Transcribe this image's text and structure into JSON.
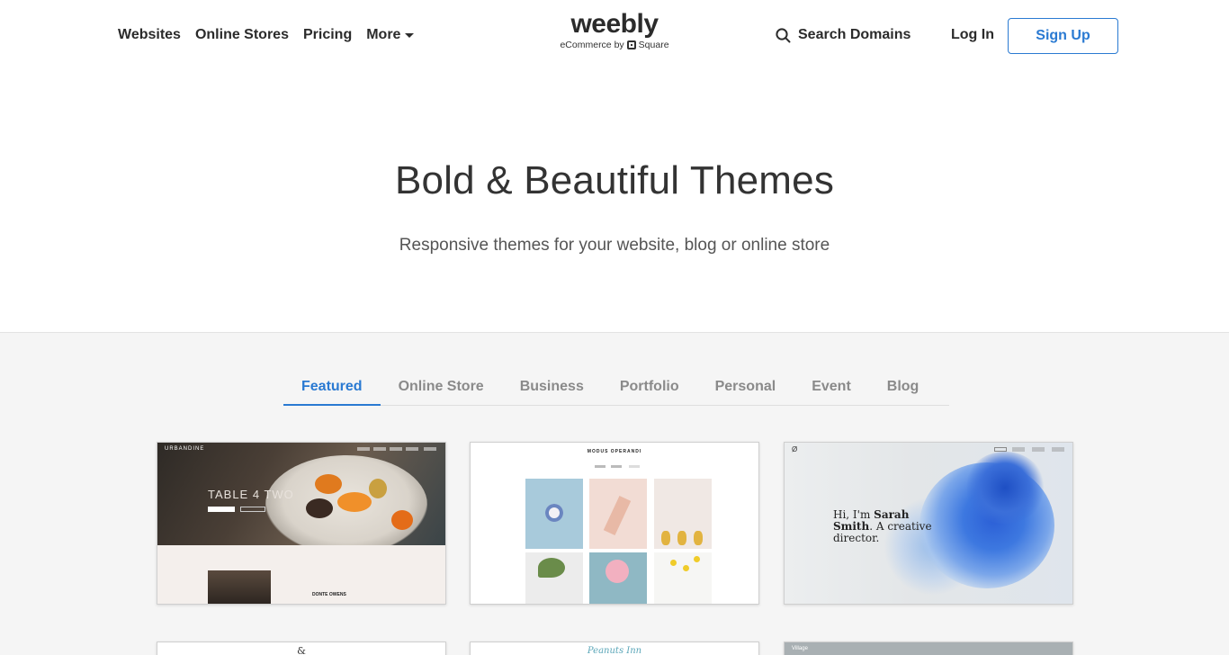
{
  "nav": {
    "websites": "Websites",
    "online_stores": "Online Stores",
    "pricing": "Pricing",
    "more": "More"
  },
  "logo": {
    "wordmark": "weebly",
    "tagline_prefix": "eCommerce by",
    "tagline_brand": "Square"
  },
  "header_actions": {
    "search": "Search Domains",
    "login": "Log In",
    "signup": "Sign Up"
  },
  "hero": {
    "title": "Bold & Beautiful Themes",
    "subtitle": "Responsive themes for your website, blog or online store"
  },
  "tabs": [
    {
      "label": "Featured",
      "active": true
    },
    {
      "label": "Online Store",
      "active": false
    },
    {
      "label": "Business",
      "active": false
    },
    {
      "label": "Portfolio",
      "active": false
    },
    {
      "label": "Personal",
      "active": false
    },
    {
      "label": "Event",
      "active": false
    },
    {
      "label": "Blog",
      "active": false
    }
  ],
  "themes": [
    {
      "brand": "URBANDINE",
      "headline": "TABLE 4 TWO",
      "name": "DONTE OWENS"
    },
    {
      "brand": "MODUS OPERANDI"
    },
    {
      "brand": "Ø",
      "headline_parts": [
        "Hi, I'm ",
        "Sarah Smith",
        ". A creative director."
      ]
    },
    {
      "brand": "&"
    },
    {
      "brand": "Peanuts Inn"
    },
    {
      "brand": "Village"
    }
  ],
  "colors": {
    "accent": "#2a7ad2",
    "tab_inactive": "#8a8a8a",
    "gray_bg": "#f5f5f5"
  }
}
